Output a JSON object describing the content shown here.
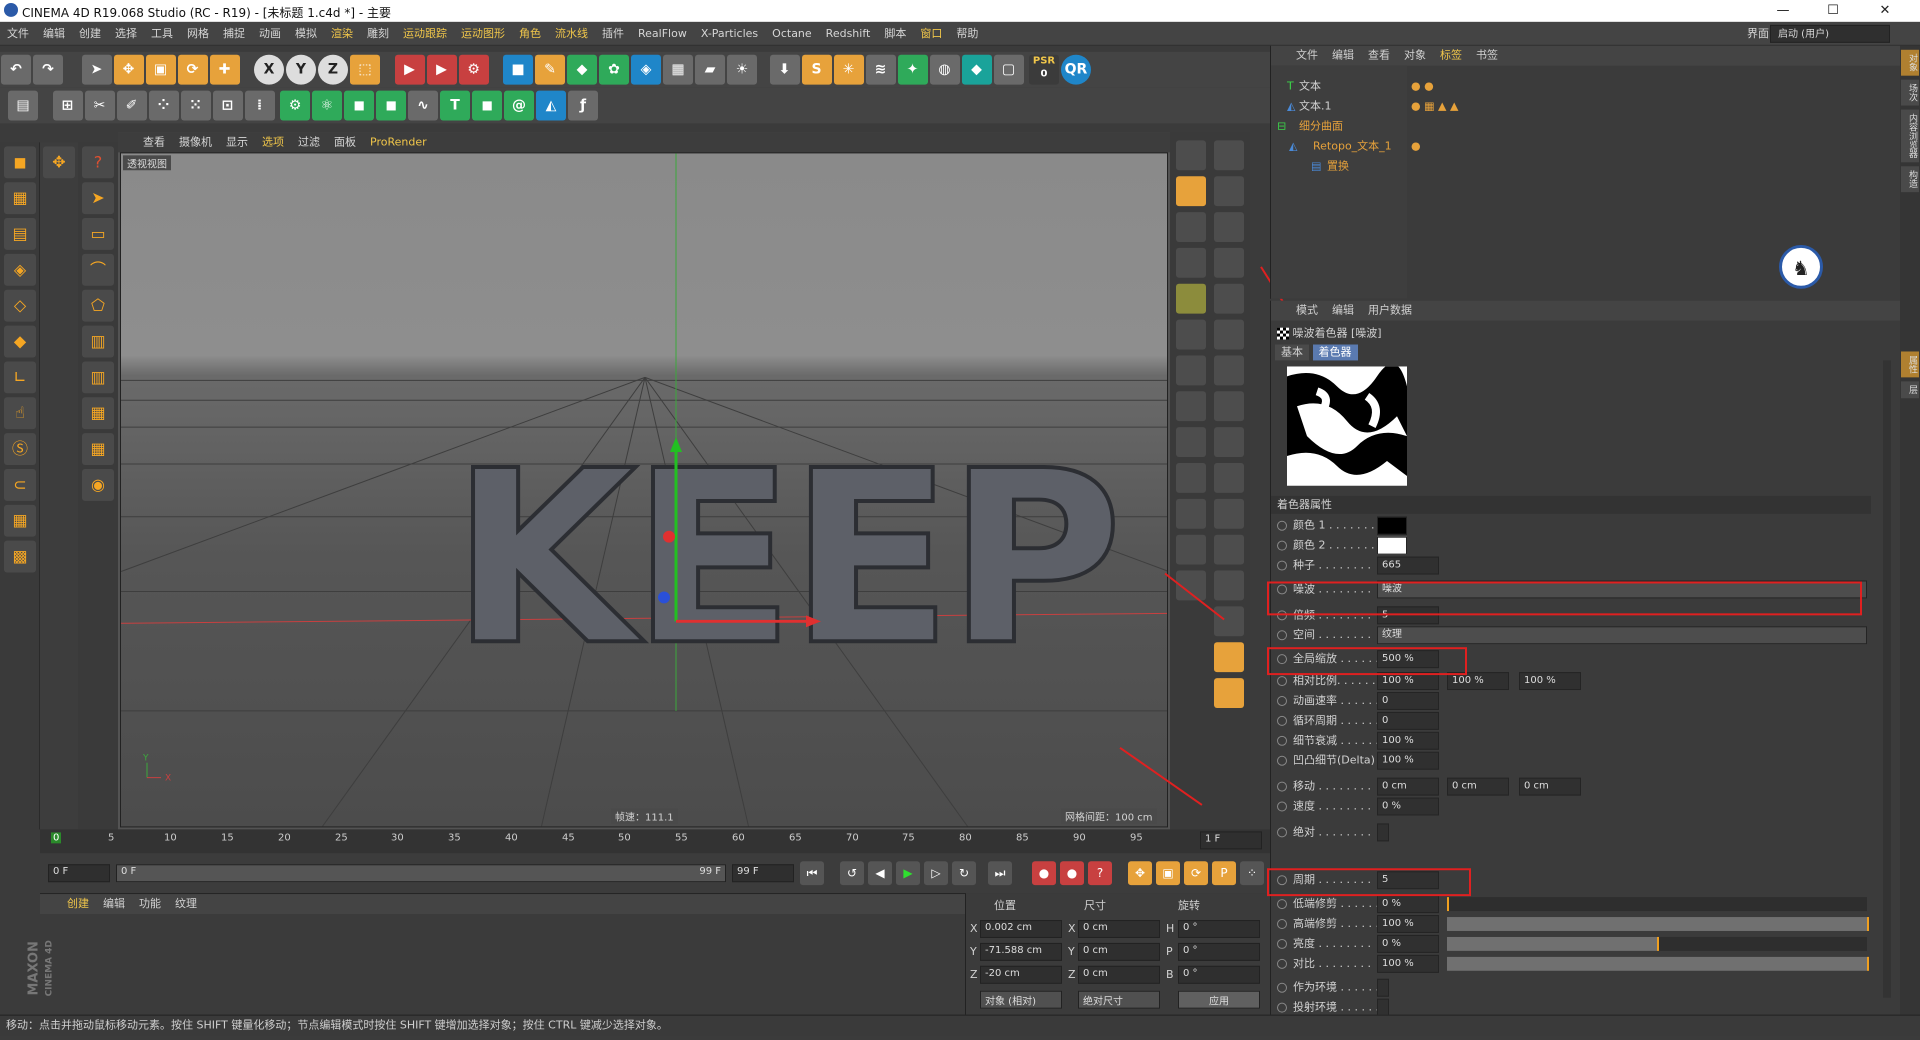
{
  "window": {
    "title": "CINEMA 4D R19.068 Studio (RC - R19) - [未标题 1.c4d *] - 主要",
    "min": "—",
    "max": "☐",
    "close": "✕"
  },
  "menu": [
    "文件",
    "编辑",
    "创建",
    "选择",
    "工具",
    "网格",
    "捕捉",
    "动画",
    "模拟",
    "渲染",
    "雕刻",
    "运动跟踪",
    "运动图形",
    "角色",
    "流水线",
    "插件",
    "RealFlow",
    "X-Particles",
    "Octane",
    "Redshift",
    "脚本",
    "窗口",
    "帮助"
  ],
  "layout": {
    "label": "界面:",
    "value": "启动 (用户)"
  },
  "toolbar": {
    "x": "X",
    "y": "Y",
    "z": "Z",
    "psr": "PSR",
    "psr_num": "0",
    "qr": "QR",
    "s": "S"
  },
  "viewport": {
    "menu": [
      "查看",
      "摄像机",
      "显示",
      "选项",
      "过滤",
      "面板",
      "ProRender"
    ],
    "label": "透视视图",
    "fps": "帧速：111.1",
    "grid": "网格间距：100 cm",
    "text3d": "KEEP"
  },
  "timeline": {
    "ticks": [
      "0",
      "5",
      "10",
      "15",
      "20",
      "25",
      "30",
      "35",
      "40",
      "45",
      "50",
      "55",
      "60",
      "65",
      "70",
      "75",
      "80",
      "85",
      "90",
      "95"
    ],
    "end": "1 F"
  },
  "playback": {
    "start": "0 F",
    "cur": "0 F",
    "range_end": "99 F",
    "end": "99 F"
  },
  "material": {
    "menu": [
      "创建",
      "编辑",
      "功能",
      "纹理"
    ],
    "brand1": "MAXON",
    "brand2": "CINEMA 4D"
  },
  "coord": {
    "h_pos": "位置",
    "h_size": "尺寸",
    "h_rot": "旋转",
    "x": "0.002 cm",
    "y": "-71.588 cm",
    "z": "-20 cm",
    "sx": "0 cm",
    "sy": "0 cm",
    "sz": "0 cm",
    "h": "0 °",
    "p": "0 °",
    "b": "0 °",
    "lx": "X",
    "ly": "Y",
    "lz": "Z",
    "lh": "H",
    "lp": "P",
    "lb": "B",
    "mode": "对象 (相对)",
    "size": "绝对尺寸",
    "apply": "应用"
  },
  "objects": {
    "menu": [
      "文件",
      "编辑",
      "查看",
      "对象",
      "标签",
      "书签"
    ],
    "items": [
      "文本",
      "文本.1",
      "细分曲面",
      "Retopo_文本_1",
      "置换"
    ]
  },
  "attr": {
    "menu": [
      "模式",
      "编辑",
      "用户数据"
    ],
    "title": "噪波着色器 [噪波]",
    "tabs": [
      "基本",
      "着色器"
    ],
    "section": "着色器属性",
    "rows": [
      {
        "l": "颜色 1 . . . . . . .",
        "v": ""
      },
      {
        "l": "颜色 2 . . . . . . .",
        "v": ""
      },
      {
        "l": "种子 . . . . . . . .",
        "v": "665"
      },
      {
        "l": "噪波 . . . . . . . .",
        "v": "噪波"
      },
      {
        "l": "倍频 . . . . . . . .",
        "v": "5"
      },
      {
        "l": "空间 . . . . . . . .",
        "v": "纹理"
      },
      {
        "l": "全局缩放 . . . . . .",
        "v": "500 %"
      },
      {
        "l": "相对比例. . . . . .",
        "v": "100 %",
        "v2": "100 %",
        "v3": "100 %"
      },
      {
        "l": "动画速率 . . . . . .",
        "v": "0"
      },
      {
        "l": "循环周期 . . . . . .",
        "v": "0"
      },
      {
        "l": "细节衰减 . . . . . .",
        "v": "100 %"
      },
      {
        "l": "凹凸细节(Delta)",
        "v": "100 %"
      },
      {
        "l": "移动 . . . . . . . .",
        "v": "0 cm",
        "v2": "0 cm",
        "v3": "0 cm"
      },
      {
        "l": "速度 . . . . . . . .",
        "v": "0 %"
      },
      {
        "l": "绝对 . . . . . . . .",
        "v": ""
      },
      {
        "l": "周期 . . . . . . . .",
        "v": "5"
      },
      {
        "l": "低端修剪 . . . . . .",
        "v": "0 %"
      },
      {
        "l": "高端修剪 . . . . . .",
        "v": "100 %"
      },
      {
        "l": "亮度 . . . . . . . .",
        "v": "0 %"
      },
      {
        "l": "对比 . . . . . . . .",
        "v": "100 %"
      },
      {
        "l": "作为环境 . . . . . .",
        "v": ""
      },
      {
        "l": "投射环境 . . . . . .",
        "v": ""
      }
    ],
    "fills": {
      "lowclip": 0,
      "highclip": 1,
      "brightness": 0.5,
      "contrast": 1
    }
  },
  "sidetabs": [
    "对象",
    "场次",
    "内容浏览器",
    "构造",
    "属性",
    "层"
  ],
  "status": "移动：点击并拖动鼠标移动元素。按住 SHIFT 键量化移动；节点编辑模式时按住 SHIFT 键增加选择对象；按住 CTRL 键减少选择对象。",
  "colors": {
    "accent": "#f0c64a",
    "red": "#e02020"
  }
}
